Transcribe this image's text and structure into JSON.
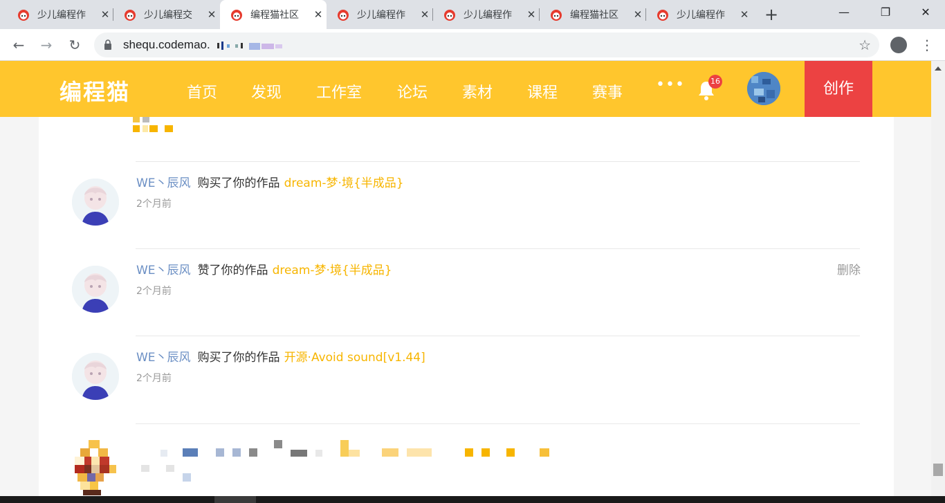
{
  "browser": {
    "tabs": [
      {
        "title": "少儿编程作",
        "active": false
      },
      {
        "title": "少儿编程交",
        "active": false
      },
      {
        "title": "编程猫社区",
        "active": true
      },
      {
        "title": "少儿编程作",
        "active": false
      },
      {
        "title": "少儿编程作",
        "active": false
      },
      {
        "title": "编程猫社区",
        "active": false
      },
      {
        "title": "少儿编程作",
        "active": false
      }
    ],
    "url": "shequ.codemao."
  },
  "site": {
    "logo": "编程猫",
    "nav": [
      "首页",
      "发现",
      "工作室",
      "论坛",
      "素材",
      "课程",
      "赛事"
    ],
    "more": "•••",
    "notification_count": "16",
    "create_label": "创作",
    "brand_color": "#ffc62d",
    "create_color": "#ec4242"
  },
  "messages": [
    {
      "user": "WE丶辰风",
      "action": "购买了你的作品",
      "work": "dream-梦·境{半成品}",
      "time": "2个月前",
      "delete_label": ""
    },
    {
      "user": "WE丶辰风",
      "action": "赞了你的作品",
      "work": "dream-梦·境{半成品}",
      "time": "2个月前",
      "delete_label": "删除"
    },
    {
      "user": "WE丶辰风",
      "action": "购买了你的作品",
      "work": "开源·Avoid sound[v1.44]",
      "time": "2个月前",
      "delete_label": ""
    }
  ]
}
